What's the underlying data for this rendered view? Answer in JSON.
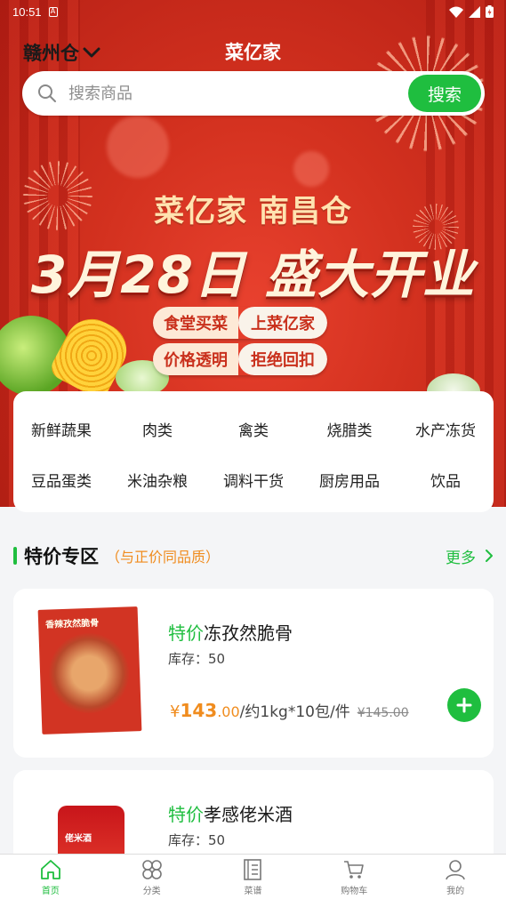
{
  "status_bar": {
    "time": "10:51",
    "notification_badge": "A"
  },
  "header": {
    "warehouse": "赣州仓",
    "app_title": "菜亿家",
    "search_placeholder": "搜索商品",
    "search_button": "搜索"
  },
  "banner": {
    "line1": "菜亿家  南昌仓",
    "line2": "3月28日  盛大开业",
    "pill1_a": "食堂买菜",
    "pill1_b": "上菜亿家",
    "pill2_a": "价格透明",
    "pill2_b": "拒绝回扣"
  },
  "categories": [
    "新鲜蔬果",
    "肉类",
    "禽类",
    "烧腊类",
    "水产冻货",
    "豆品蛋类",
    "米油杂粮",
    "调料干货",
    "厨房用品",
    "饮品"
  ],
  "special_section": {
    "title": "特价专区",
    "subtitle": "（与正价同品质）",
    "more": "更多"
  },
  "products": [
    {
      "tag": "特价",
      "name": "冻孜然脆骨",
      "stock": "库存：50",
      "currency": "¥",
      "price_int": "143",
      "price_dec": ".00",
      "unit": "/约1kg*10包/件",
      "original_price": "¥145.00",
      "thumb_label": "香辣孜然脆骨"
    },
    {
      "tag": "特价",
      "name": "孝感佬米酒",
      "stock": "库存：50",
      "thumb_label": "佬米酒"
    }
  ],
  "tabbar": [
    {
      "label": "首页",
      "icon": "home-icon",
      "active": true
    },
    {
      "label": "分类",
      "icon": "category-icon",
      "active": false
    },
    {
      "label": "菜谱",
      "icon": "recipe-icon",
      "active": false
    },
    {
      "label": "购物车",
      "icon": "cart-icon",
      "active": false
    },
    {
      "label": "我的",
      "icon": "user-icon",
      "active": false
    }
  ],
  "colors": {
    "accent_green": "#1fbe3f",
    "price_orange": "#f08c1e",
    "banner_red": "#d3311f"
  }
}
